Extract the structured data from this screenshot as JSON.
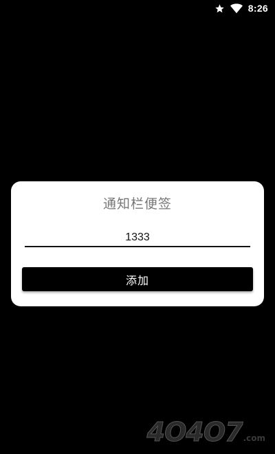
{
  "status_bar": {
    "time": "8:26",
    "icons": [
      "star-icon",
      "wifi-icon"
    ]
  },
  "dialog": {
    "title": "通知栏便签",
    "input_value": "1333",
    "add_label": "添加"
  },
  "watermark": {
    "text": "4O4O7",
    "suffix": ".com"
  },
  "colors": {
    "background": "#000000",
    "dialog_background": "#ffffff",
    "title_text": "#777777",
    "button_background": "#000000",
    "button_text": "#ffffff"
  }
}
